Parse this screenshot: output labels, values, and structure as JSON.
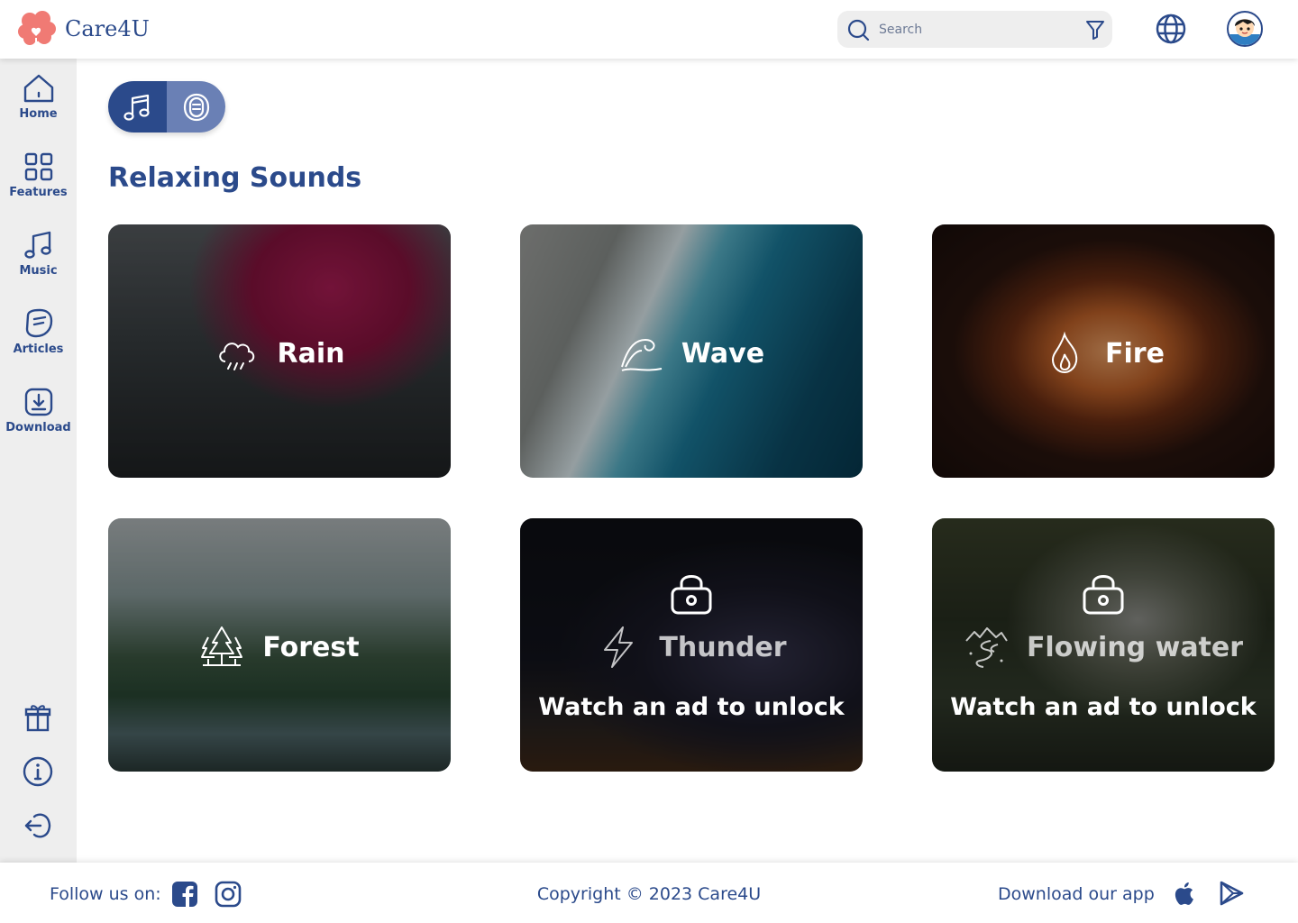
{
  "brand": {
    "name": "Care4U"
  },
  "search": {
    "placeholder": "Search"
  },
  "sidebar": {
    "items": [
      {
        "label": "Home",
        "icon": "home-icon"
      },
      {
        "label": "Features",
        "icon": "grid-icon"
      },
      {
        "label": "Music",
        "icon": "music-note-icon"
      },
      {
        "label": "Articles",
        "icon": "articles-icon"
      },
      {
        "label": "Download",
        "icon": "download-icon"
      }
    ],
    "bottom_icons": [
      "gift-icon",
      "info-icon",
      "logout-icon"
    ]
  },
  "toggle": {
    "active": "music",
    "options": [
      "music-note-icon",
      "meditation-icon"
    ]
  },
  "main": {
    "title": "Relaxing Sounds",
    "cards": [
      {
        "label": "Rain",
        "icon": "rain-cloud-icon",
        "locked": false
      },
      {
        "label": "Wave",
        "icon": "wave-icon",
        "locked": false
      },
      {
        "label": "Fire",
        "icon": "flame-icon",
        "locked": false
      },
      {
        "label": "Forest",
        "icon": "forest-icon",
        "locked": false
      },
      {
        "label": "Thunder",
        "icon": "lightning-icon",
        "locked": true,
        "unlock_text": "Watch an ad to unlock"
      },
      {
        "label": "Flowing water",
        "icon": "stream-icon",
        "locked": true,
        "unlock_text": "Watch an ad to unlock"
      }
    ]
  },
  "footer": {
    "follow_label": "Follow us on:",
    "copyright": "Copyright © 2023 Care4U",
    "download_label": "Download our app",
    "social": [
      "facebook-icon",
      "instagram-icon"
    ],
    "stores": [
      "apple-icon",
      "google-play-icon"
    ]
  },
  "colors": {
    "primary": "#2b4a8b",
    "sidebar_bg": "#eeeeee",
    "toggle_inactive": "#6a80b5",
    "logo": "#f07a74"
  }
}
